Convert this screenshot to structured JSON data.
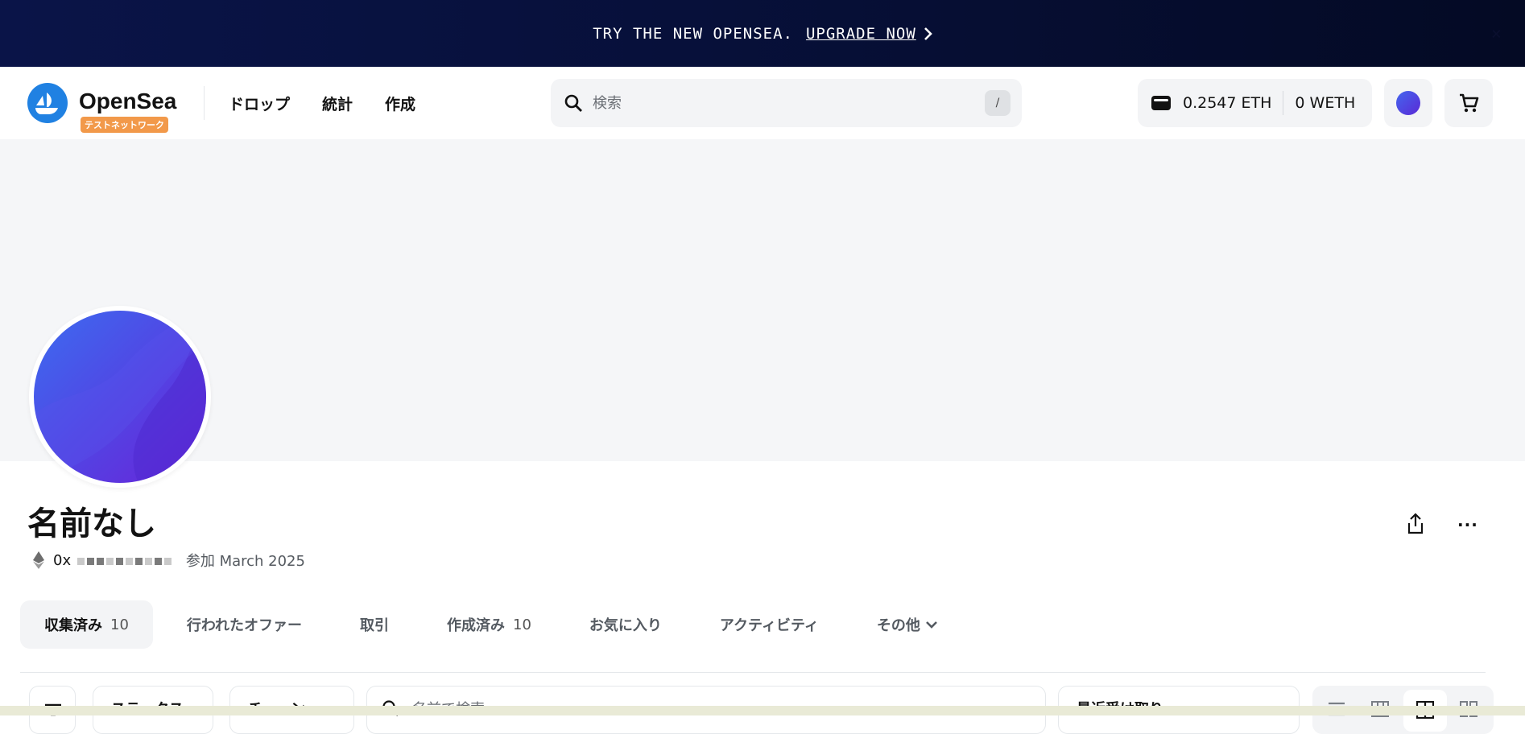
{
  "promo": {
    "text": "TRY THE NEW OPENSEA.",
    "link": "UPGRADE NOW",
    "close": "×"
  },
  "header": {
    "logo_text": "OpenSea",
    "network_badge": "テストネットワーク",
    "nav": [
      "ドロップ",
      "統計",
      "作成"
    ],
    "search_placeholder": "検索",
    "search_shortcut": "/",
    "wallet_eth": "0.2547 ETH",
    "wallet_weth": "0 WETH"
  },
  "profile": {
    "name": "名前なし",
    "address_prefix": "0x",
    "joined": "参加 March 2025"
  },
  "tabs": [
    {
      "label": "収集済み",
      "count": "10",
      "active": true
    },
    {
      "label": "行われたオファー",
      "count": ""
    },
    {
      "label": "取引",
      "count": ""
    },
    {
      "label": "作成済み",
      "count": "10"
    },
    {
      "label": "お気に入り",
      "count": ""
    },
    {
      "label": "アクティビティ",
      "count": ""
    },
    {
      "label": "その他",
      "count": ""
    }
  ],
  "filters": {
    "status_label": "ステータス",
    "chain_label": "チェーン",
    "search_placeholder": "名前で検索",
    "sort_label": "最近受け取り"
  },
  "colors": {
    "accent": "#2081e2",
    "testnet_badge": "#f2994a",
    "avatar_gradient_start": "#4466ee",
    "avatar_gradient_end": "#5a2ad6"
  }
}
